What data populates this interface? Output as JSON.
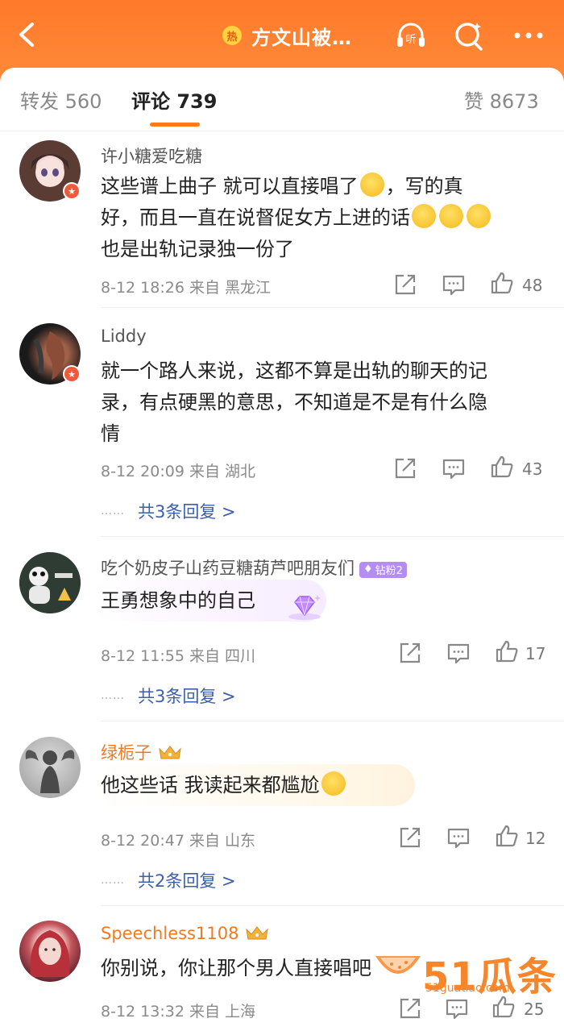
{
  "header": {
    "hot_badge": "热",
    "title": "方文山被…",
    "listen_label": "听",
    "icons": [
      "back-icon",
      "listen-icon",
      "search-icon",
      "more-icon"
    ],
    "accent": "#ff7a2a"
  },
  "tabs": {
    "repost_label": "转发",
    "repost_count": "560",
    "comment_label": "评论",
    "comment_count": "739",
    "like_label": "赞",
    "like_count": "8673"
  },
  "comments": [
    {
      "user": "许小糖爱吃糖",
      "lines": [
        "这些谱上曲子 就可以直接唱了",
        "，写的真",
        "好，而且一直在说督促女方上进的话",
        "也是出轨记录独一份了"
      ],
      "date": "8-12 18:26",
      "from": "来自",
      "location": "黑龙江",
      "likes": "48"
    },
    {
      "user": "Liddy",
      "lines": [
        "就一个路人来说，这都不算是出轨的聊天的记",
        "录，有点硬黑的意思，不知道是不是有什么隐",
        "情"
      ],
      "date": "8-12 20:09",
      "from": "来自",
      "location": "湖北",
      "likes": "43",
      "replies": "共3条回复 >"
    },
    {
      "user": "吃个奶皮子山药豆糖葫芦吧朋友们",
      "badge": "钻粉2",
      "lines": [
        "王勇想象中的自己"
      ],
      "date": "8-12 11:55",
      "from": "来自",
      "location": "四川",
      "likes": "17",
      "replies": "共3条回复 >"
    },
    {
      "user": "绿栀子",
      "lines": [
        "他这些话 我读起来都尴尬"
      ],
      "date": "8-12 20:47",
      "from": "来自",
      "location": "山东",
      "likes": "12",
      "replies": "共2条回复 >"
    },
    {
      "user": "Speechless1108",
      "lines": [
        "你别说，你让那个男人直接唱吧"
      ],
      "date": "8-12 13:32",
      "from": "来自",
      "location": "上海",
      "likes": "25"
    }
  ],
  "reply_dots": "……",
  "watermark": {
    "big": "51瓜条",
    "small": "51guatiao.com"
  }
}
